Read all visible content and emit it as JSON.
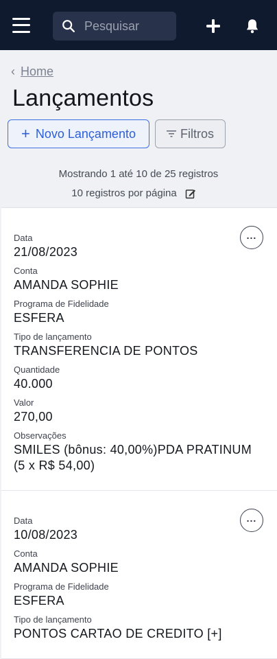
{
  "header": {
    "search_placeholder": "Pesquisar",
    "icons": [
      "menu-icon",
      "search-icon",
      "plus-icon",
      "bell-icon"
    ]
  },
  "breadcrumb": {
    "home": "Home"
  },
  "page": {
    "title": "Lançamentos"
  },
  "toolbar": {
    "new_label": "Novo Lançamento",
    "filter_label": "Filtros"
  },
  "pagination": {
    "showing": "Mostrando 1 até 10 de 25 registros",
    "per_page": "10 registros por página"
  },
  "labels": {
    "date": "Data",
    "account": "Conta",
    "program": "Programa de Fidelidade",
    "type": "Tipo de lançamento",
    "quantity": "Quantidade",
    "value": "Valor",
    "notes": "Observações"
  },
  "entries": [
    {
      "date": "21/08/2023",
      "account": "AMANDA SOPHIE",
      "program": "ESFERA",
      "type": "TRANSFERENCIA DE PONTOS",
      "quantity": "40.000",
      "value": "270,00",
      "notes": "SMILES  (bônus: 40,00%)PDA PRATINUM  (5 x R$ 54,00)"
    },
    {
      "date": "10/08/2023",
      "account": "AMANDA SOPHIE",
      "program": "ESFERA",
      "type": "PONTOS CARTAO DE CREDITO [+]"
    }
  ],
  "colors": {
    "topbar": "#0f1a2e",
    "accent": "#2d5fd6"
  }
}
